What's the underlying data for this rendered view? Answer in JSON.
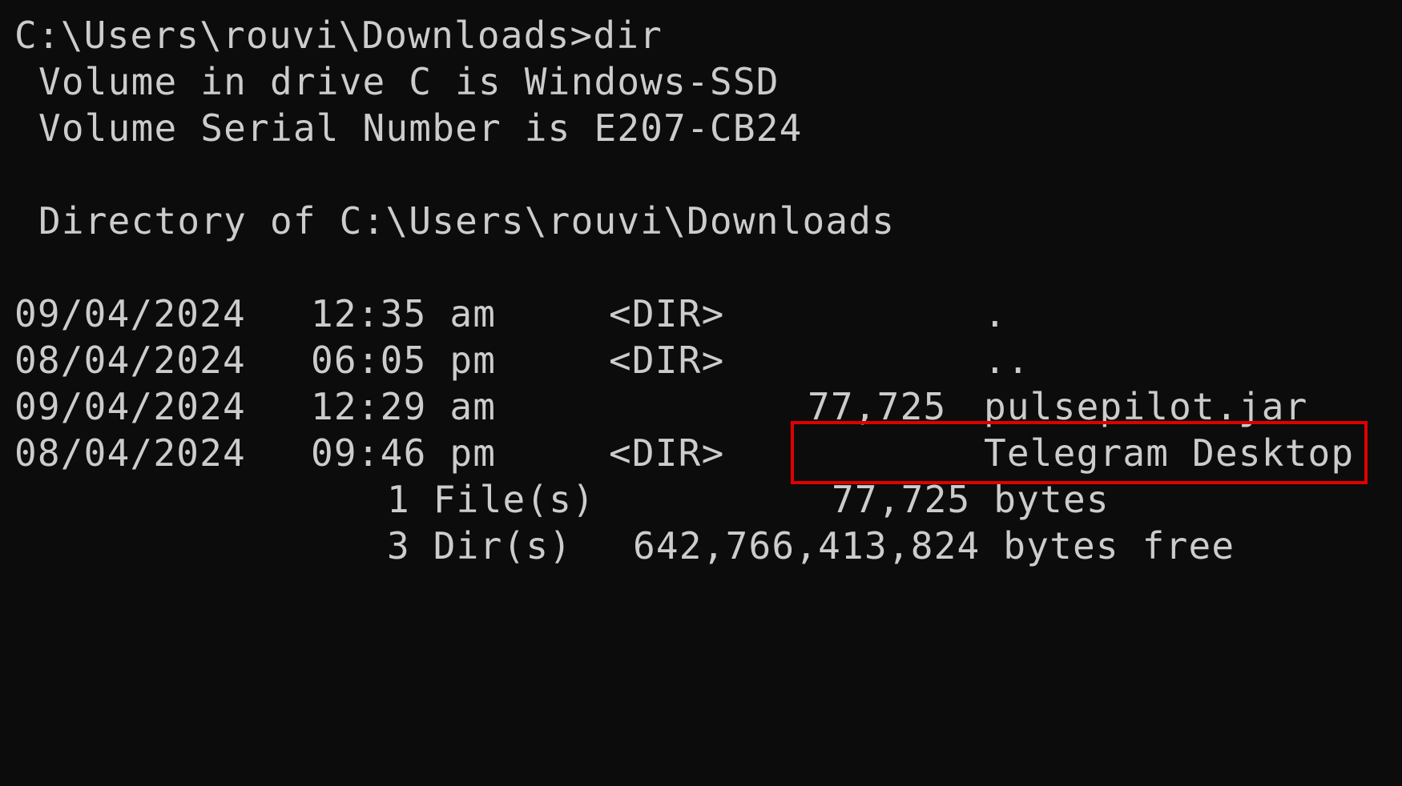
{
  "terminal": {
    "prompt_path": "C:\\Users\\rouvi\\Downloads>",
    "command": "dir",
    "volume_label_line": "Volume in drive C is Windows-SSD",
    "serial_line": "Volume Serial Number is E207-CB24",
    "directory_line": "Directory of C:\\Users\\rouvi\\Downloads",
    "entries": [
      {
        "date": "09/04/2024",
        "time": "12:35 am",
        "type": "<DIR>",
        "size": "",
        "name": "."
      },
      {
        "date": "08/04/2024",
        "time": "06:05 pm",
        "type": "<DIR>",
        "size": "",
        "name": ".."
      },
      {
        "date": "09/04/2024",
        "time": "12:29 am",
        "type": "",
        "size": "77,725",
        "name": "pulsepilot.jar"
      },
      {
        "date": "08/04/2024",
        "time": "09:46 pm",
        "type": "<DIR>",
        "size": "",
        "name": "Telegram Desktop"
      }
    ],
    "summary": {
      "files_count": "1 File(s)",
      "files_bytes": "77,725 bytes",
      "dirs_count": "3 Dir(s)",
      "dirs_free": "642,766,413,824 bytes free"
    }
  },
  "annotation": {
    "highlight_color": "#e00000"
  }
}
